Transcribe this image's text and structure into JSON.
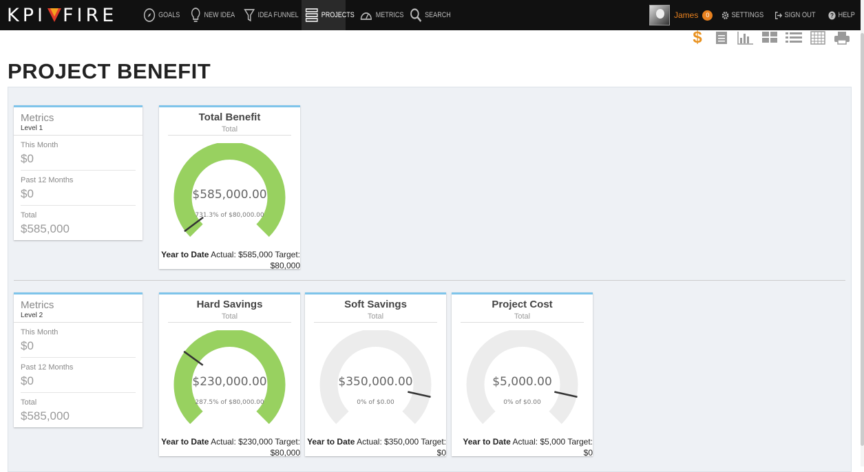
{
  "nav": {
    "logo_left": "KPI",
    "logo_right": "FIRE",
    "items": [
      {
        "label": "Goals",
        "icon": "compass-icon"
      },
      {
        "label": "New Idea",
        "icon": "lightbulb-icon"
      },
      {
        "label": "Idea Funnel",
        "icon": "funnel-icon"
      },
      {
        "label": "Projects",
        "icon": "projects-icon",
        "active": true
      },
      {
        "label": "Metrics",
        "icon": "speedometer-icon"
      },
      {
        "label": "Search",
        "icon": "search-icon"
      }
    ],
    "user_name": "James",
    "notification_count": "0",
    "settings_label": "Settings",
    "signout_label": "Sign Out",
    "help_label": "Help"
  },
  "toolbar": {
    "icons": [
      "dollar-icon",
      "document-icon",
      "bar-chart-icon",
      "grid-icon",
      "list-icon",
      "table-icon",
      "print-icon"
    ],
    "dollar_glyph": "$"
  },
  "page": {
    "title": "PROJECT BENEFIT"
  },
  "levels": [
    {
      "title": "Metrics",
      "level": "Level 1",
      "rows": [
        {
          "label": "This Month",
          "value": "$0"
        },
        {
          "label": "Past 12 Months",
          "value": "$0"
        },
        {
          "label": "Total",
          "value": "$585,000"
        }
      ],
      "gauges": [
        {
          "title": "Total Benefit",
          "subtitle": "Total",
          "amount": "$585,000.00",
          "pct_text": "731.3% of $80,000.00",
          "ytd_label": "Year to Date",
          "actual_text": "Actual: $585,000",
          "target_text": "Target: $80,000",
          "fill": 1.0,
          "color": "#98d160",
          "needle": 0.03
        }
      ]
    },
    {
      "title": "Metrics",
      "level": "Level 2",
      "rows": [
        {
          "label": "This Month",
          "value": "$0"
        },
        {
          "label": "Past 12 Months",
          "value": "$0"
        },
        {
          "label": "Total",
          "value": "$585,000"
        }
      ],
      "gauges": [
        {
          "title": "Hard Savings",
          "subtitle": "Total",
          "amount": "$230,000.00",
          "pct_text": "287.5% of $80,000.00",
          "ytd_label": "Year to Date",
          "actual_text": "Actual: $230,000",
          "target_text": "Target: $80,000",
          "fill": 1.0,
          "color": "#98d160",
          "needle": 0.3
        },
        {
          "title": "Soft Savings",
          "subtitle": "Total",
          "amount": "$350,000.00",
          "pct_text": "0% of $0.00",
          "ytd_label": "Year to Date",
          "actual_text": "Actual: $350,000",
          "target_text": "Target: $0",
          "fill": 0,
          "color": "#98d160",
          "needle": 0.88
        },
        {
          "title": "Project Cost",
          "subtitle": "Total",
          "amount": "$5,000.00",
          "pct_text": "0% of $0.00",
          "ytd_label": "Year to Date",
          "actual_text": "Actual: $5,000",
          "target_text": "Target: $0",
          "fill": 0,
          "color": "#98d160",
          "needle": 0.88
        }
      ]
    }
  ],
  "colors": {
    "accent": "#e8811f",
    "card_border": "#7ec4ea",
    "gauge_track": "#ececec",
    "gauge_fill": "#98d160"
  }
}
